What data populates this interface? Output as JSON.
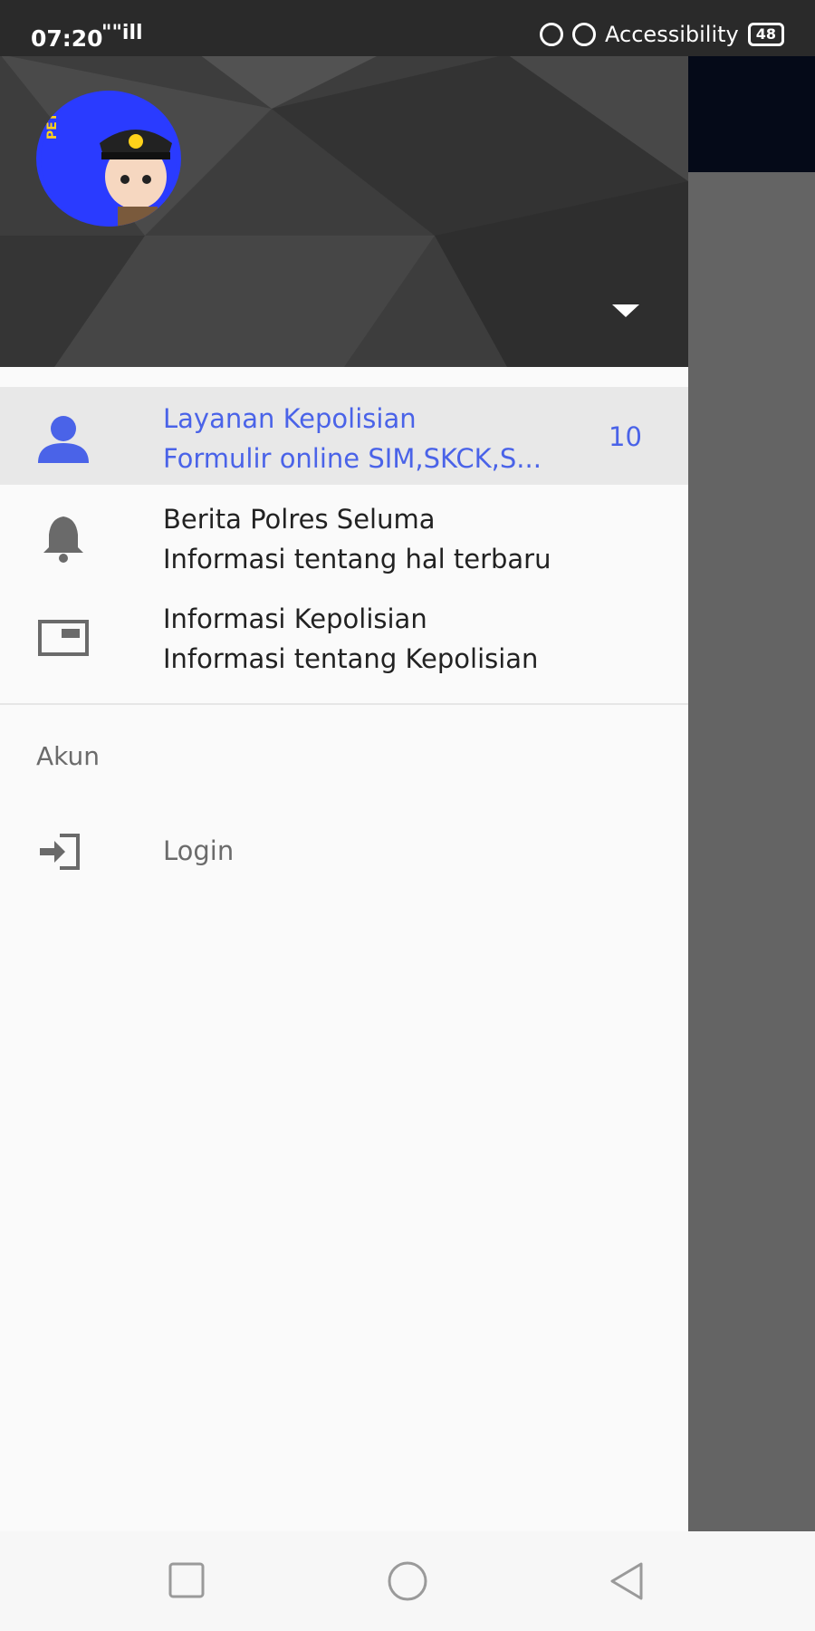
{
  "status_bar": {
    "time": "07:20",
    "signal": "\"\"ill",
    "accessibility_label": "Accessibility",
    "battery_level": "48"
  },
  "drawer": {
    "header": {
      "avatar_text": "PETUGAS"
    },
    "items": [
      {
        "title": "Layanan Kepolisian",
        "subtitle": "Formulir online SIM,SKCK,S...",
        "count": "10",
        "icon": "person-icon",
        "active": true
      },
      {
        "title": "Berita Polres Seluma",
        "subtitle": "Informasi tentang hal terbaru",
        "icon": "bell-icon"
      },
      {
        "title": "Informasi Kepolisian",
        "subtitle": "Informasi tentang Kepolisian",
        "icon": "card-icon"
      }
    ],
    "account_section": {
      "label": "Akun",
      "login_label": "Login",
      "login_icon": "login-icon"
    }
  },
  "colors": {
    "accent": "#4a63e8",
    "app_bar": "#0d1b3d",
    "header_bg": "#3b3b3b"
  },
  "nav_bar": {
    "buttons": [
      "recents-button",
      "home-button",
      "back-button"
    ]
  }
}
